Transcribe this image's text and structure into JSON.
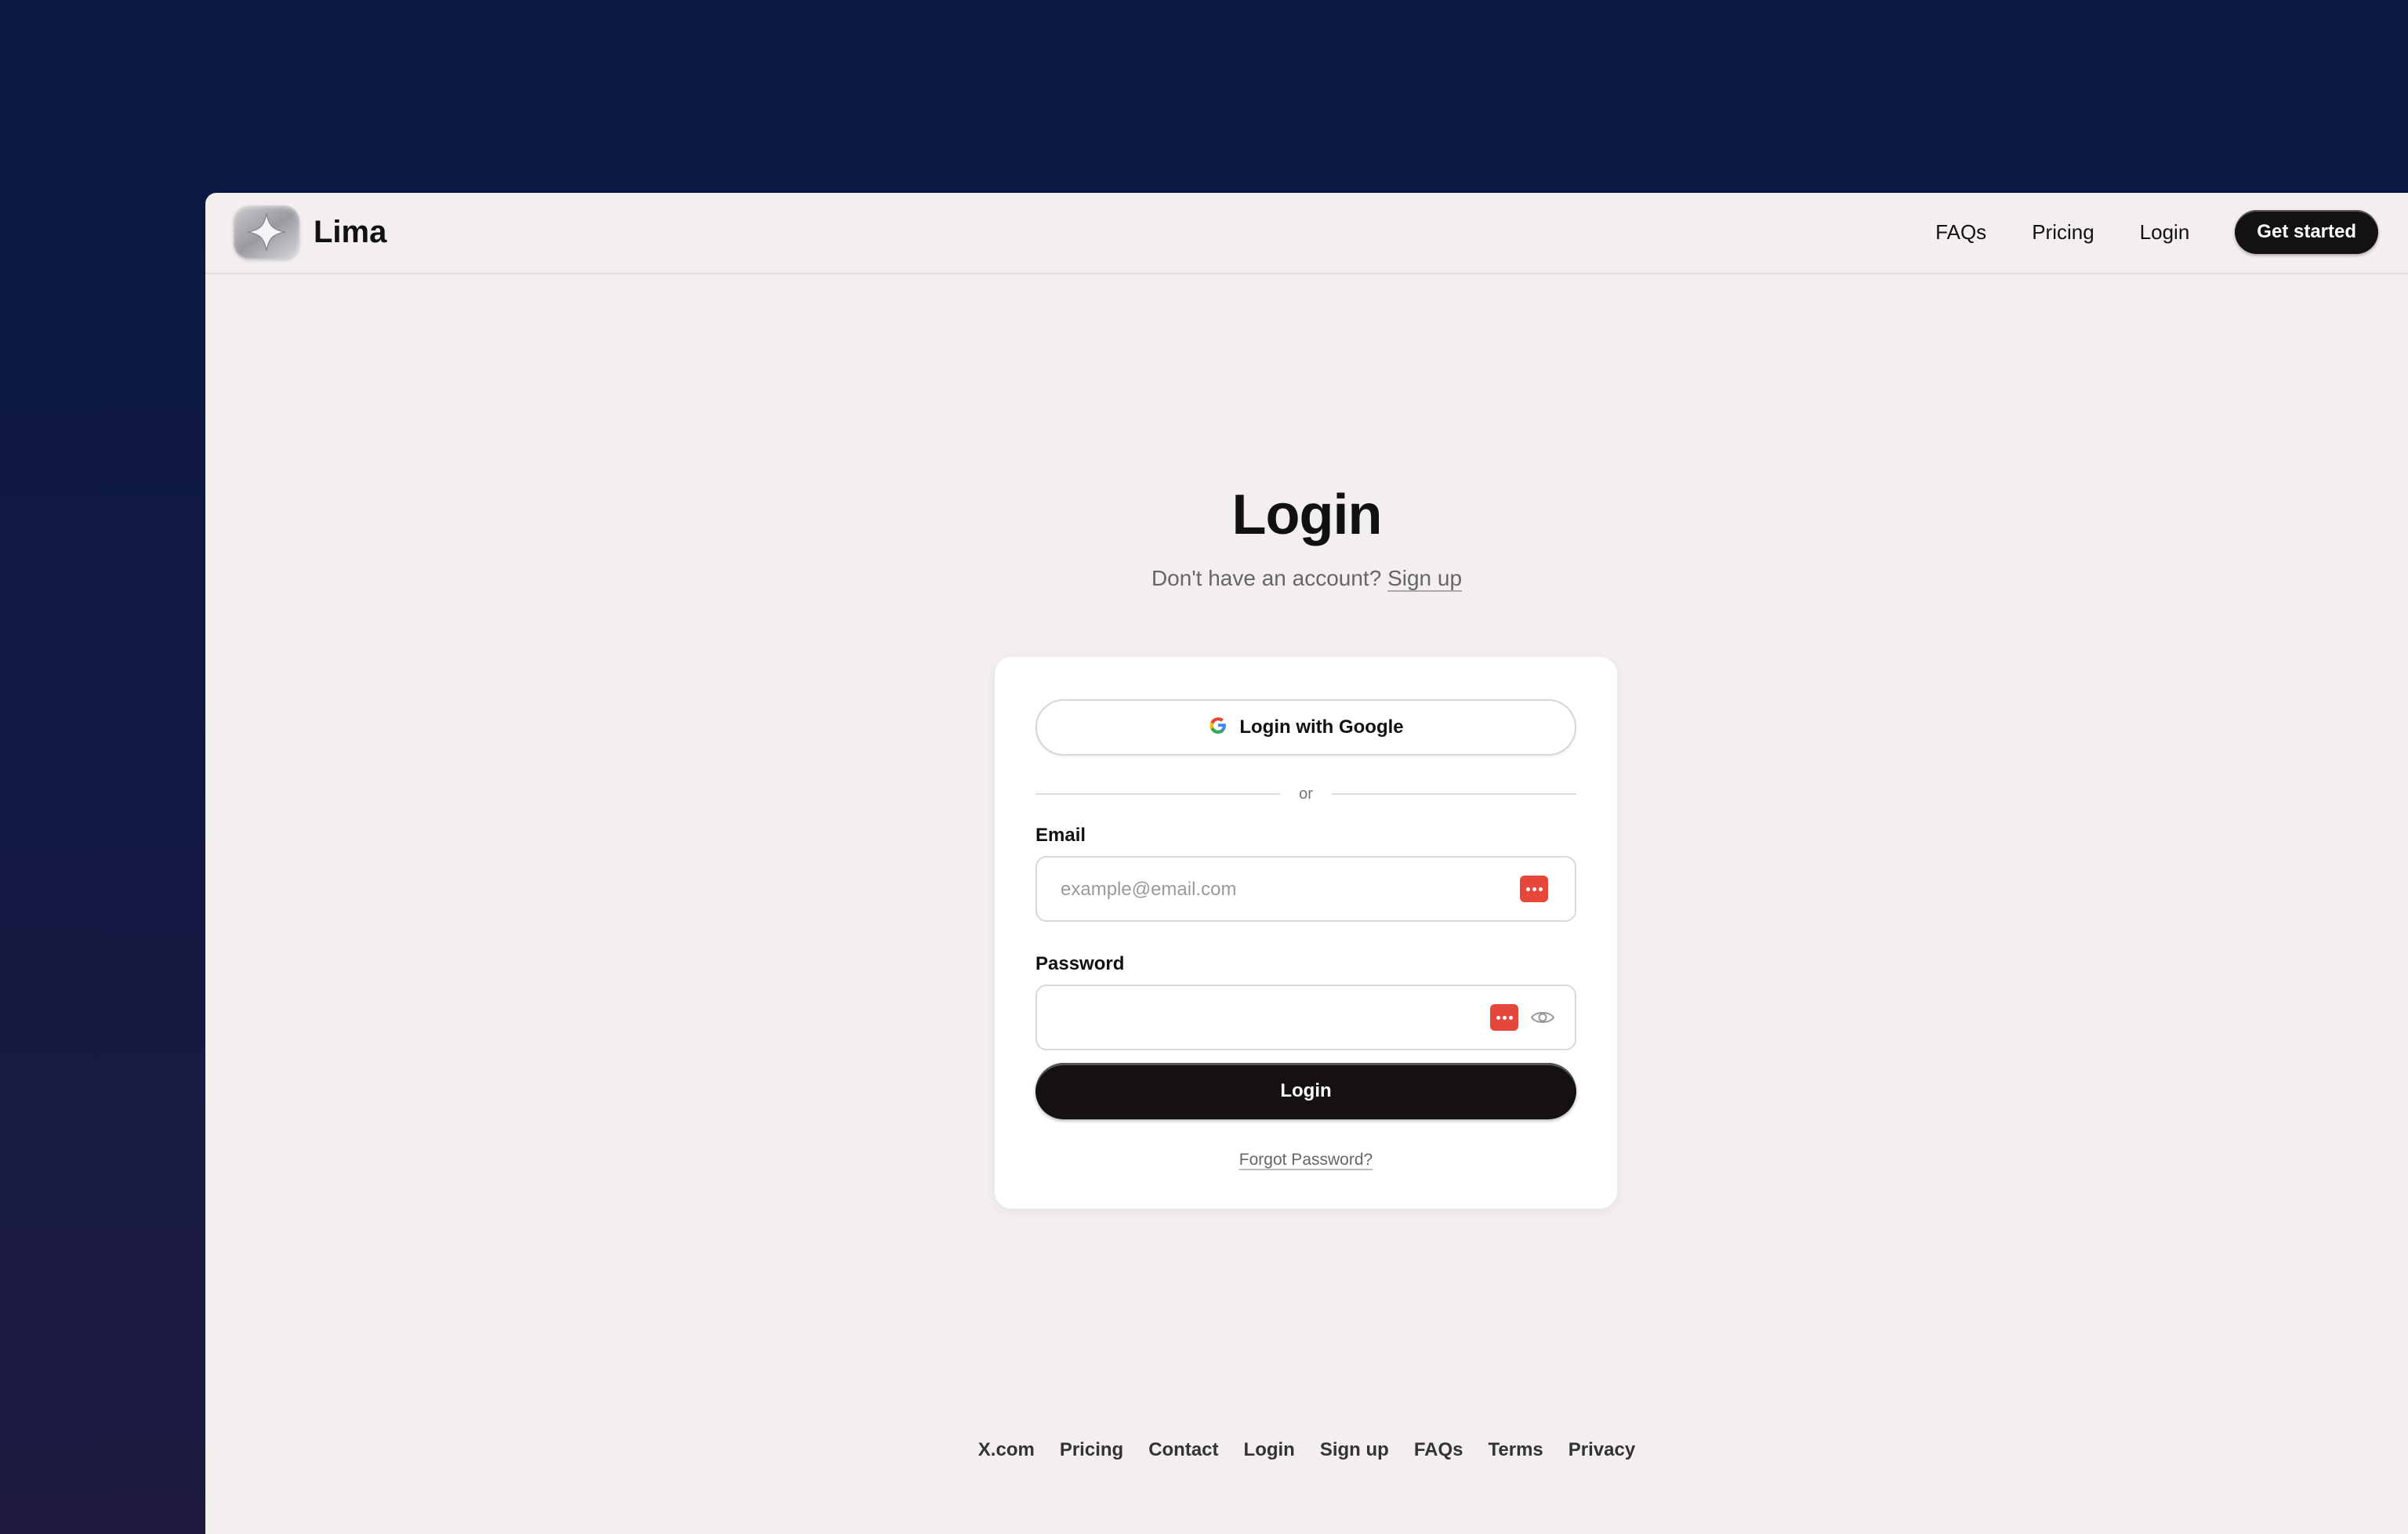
{
  "brand": {
    "name": "Lima",
    "logo_icon": "lima-star-logo-icon"
  },
  "nav": {
    "links": [
      "FAQs",
      "Pricing",
      "Login"
    ],
    "cta": "Get started"
  },
  "login": {
    "title": "Login",
    "prompt": "Don't have an account?",
    "signup_link": "Sign up",
    "google_button": "Login with Google",
    "divider_text": "or",
    "email_label": "Email",
    "email_placeholder": "example@email.com",
    "email_value": "",
    "password_label": "Password",
    "password_value": "",
    "submit_button": "Login",
    "forgot_link": "Forgot Password?"
  },
  "footer": {
    "links": [
      "X.com",
      "Pricing",
      "Contact",
      "Login",
      "Sign up",
      "FAQs",
      "Terms",
      "Privacy"
    ]
  },
  "colors": {
    "page_background": "#0b1840",
    "window_background": "#f3efef",
    "primary_button": "#151111",
    "password_manager_icon": "#e5483a"
  }
}
